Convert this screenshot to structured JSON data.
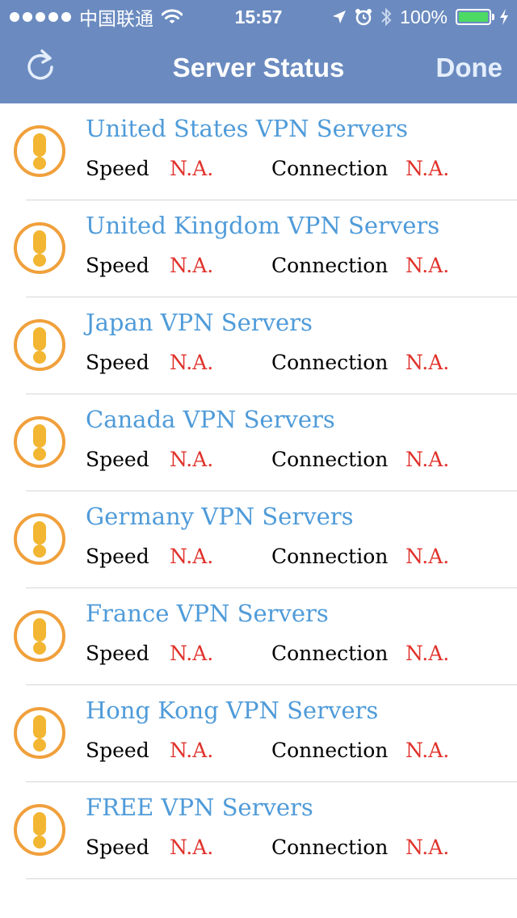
{
  "status_bar": {
    "carrier": "中国联通",
    "time": "15:57",
    "battery": "100%",
    "battery_color": "#4cd964"
  },
  "nav": {
    "title": "Server Status",
    "done_label": "Done",
    "refresh_icon": "refresh-icon"
  },
  "colors": {
    "header_bg": "#6b8bc0",
    "server_name": "#4f9bd9",
    "na_value": "#e0322b",
    "warning_ring": "#f0a03c",
    "warning_fill": "#f2b632"
  },
  "speed_label": "Speed",
  "connection_label": "Connection",
  "servers": [
    {
      "name": "United States VPN Servers",
      "speed": "N.A.",
      "connection": "N.A."
    },
    {
      "name": "United Kingdom VPN Servers",
      "speed": "N.A.",
      "connection": "N.A."
    },
    {
      "name": "Japan VPN Servers",
      "speed": "N.A.",
      "connection": "N.A."
    },
    {
      "name": "Canada VPN Servers",
      "speed": "N.A.",
      "connection": "N.A."
    },
    {
      "name": "Germany VPN Servers",
      "speed": "N.A.",
      "connection": "N.A."
    },
    {
      "name": "France VPN Servers",
      "speed": "N.A.",
      "connection": "N.A."
    },
    {
      "name": "Hong Kong VPN Servers",
      "speed": "N.A.",
      "connection": "N.A."
    },
    {
      "name": "FREE VPN Servers",
      "speed": "N.A.",
      "connection": "N.A."
    }
  ]
}
